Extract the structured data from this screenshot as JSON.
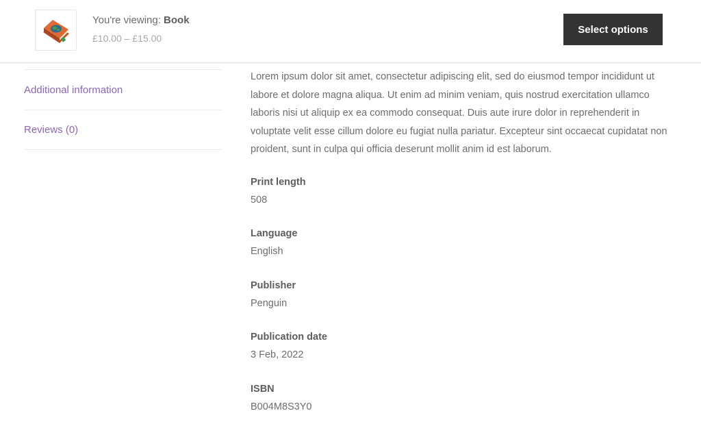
{
  "sticky_bar": {
    "viewing_prefix": "You're viewing: ",
    "product_name": "Book",
    "price_range": "£10.00 – £15.00",
    "select_button_label": "Select options",
    "thumbnail_icon": "book-icon"
  },
  "tabs": [
    {
      "label": "Additional information"
    },
    {
      "label": "Reviews (0)"
    }
  ],
  "description": "Lorem ipsum dolor sit amet, consectetur adipiscing elit, sed do eiusmod tempor incididunt ut labore et dolore magna aliqua. Ut enim ad minim veniam, quis nostrud exercitation ullamco laboris nisi ut aliquip ex ea commodo consequat. Duis aute irure dolor in reprehenderit in voluptate velit esse cillum dolore eu fugiat nulla pariatur. Excepteur sint occaecat cupidatat non proident, sunt in culpa qui officia deserunt mollit anim id est laborum.",
  "attributes": [
    {
      "label": "Print length",
      "value": "508"
    },
    {
      "label": "Language",
      "value": "English"
    },
    {
      "label": "Publisher",
      "value": "Penguin"
    },
    {
      "label": "Publication date",
      "value": "3 Feb, 2022"
    },
    {
      "label": "ISBN",
      "value": "B004M8S3Y0"
    }
  ],
  "colors": {
    "button_bg": "#333333",
    "tab_link": "#8a67b3",
    "text": "#6d6d6d",
    "price": "#a8a8a8"
  }
}
